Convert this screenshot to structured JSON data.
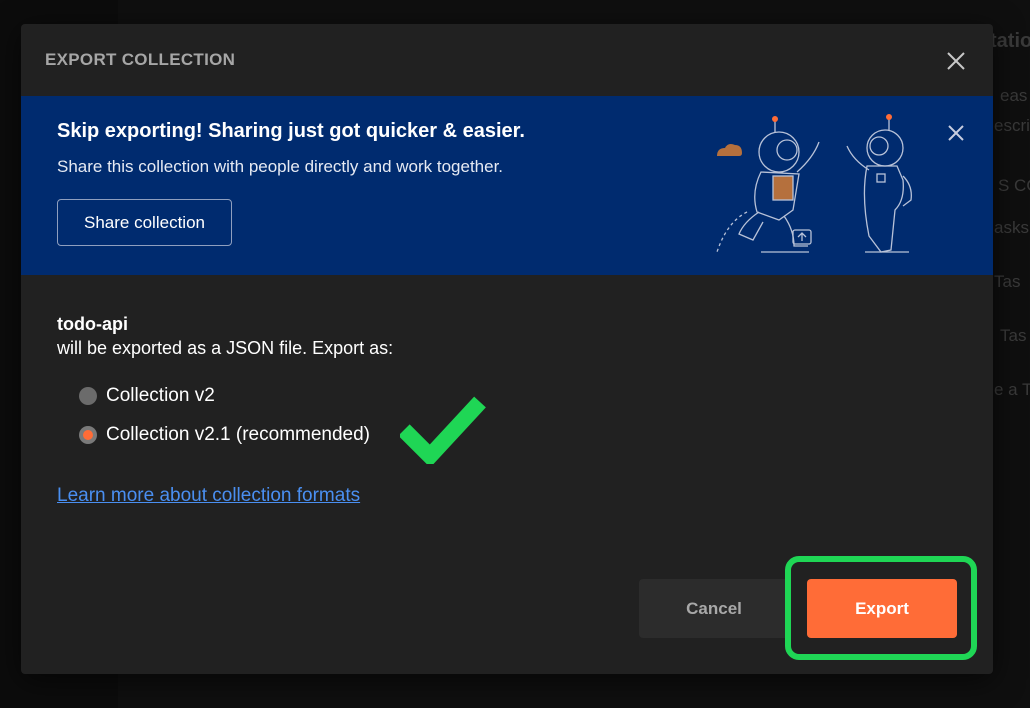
{
  "background": {
    "snippets": [
      "tatio",
      "eas",
      "escri",
      "S CO",
      "asks",
      "Tas",
      "Tas",
      "e a T"
    ]
  },
  "dialog": {
    "title": "EXPORT COLLECTION",
    "close_icon": "close-icon",
    "banner": {
      "title": "Skip exporting! Sharing just got quicker & easier.",
      "subtitle": "Share this collection with people directly and work together.",
      "share_button": "Share collection",
      "close_icon": "close-icon",
      "illustration": "astronauts-illustration"
    },
    "collection_name": "todo-api",
    "description": "will be exported as a JSON file. Export as:",
    "options": [
      {
        "label": "Collection v2",
        "selected": false
      },
      {
        "label": "Collection v2.1 (recommended)",
        "selected": true
      }
    ],
    "annotation_icon": "green-checkmark-icon",
    "learn_more_link": "Learn more about collection formats",
    "cancel_button": "Cancel",
    "export_button": "Export"
  },
  "colors": {
    "modal_bg": "#212121",
    "banner_bg": "#002b6f",
    "accent": "#ff6c37",
    "link": "#4a8ff1",
    "highlight": "#1fd655"
  }
}
